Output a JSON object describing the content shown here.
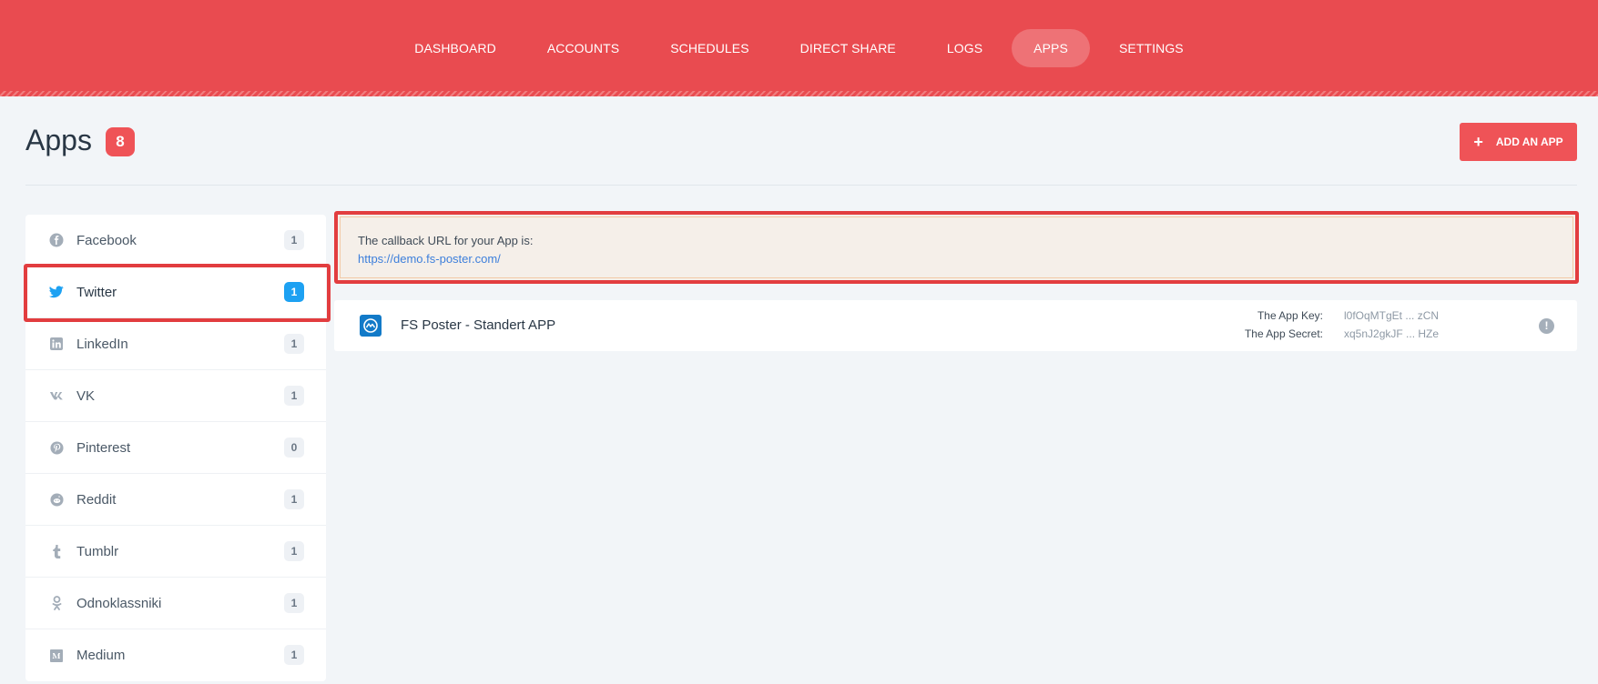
{
  "nav": {
    "items": [
      {
        "label": "DASHBOARD"
      },
      {
        "label": "ACCOUNTS"
      },
      {
        "label": "SCHEDULES"
      },
      {
        "label": "DIRECT SHARE"
      },
      {
        "label": "LOGS"
      },
      {
        "label": "APPS",
        "active": true
      },
      {
        "label": "SETTINGS"
      }
    ]
  },
  "header": {
    "title": "Apps",
    "count": "8",
    "add_button_label": "ADD AN APP",
    "add_button_icon": "+"
  },
  "sidebar": {
    "items": [
      {
        "label": "Facebook",
        "count": "1",
        "icon": "facebook-icon",
        "glyph": "f"
      },
      {
        "label": "Twitter",
        "count": "1",
        "icon": "twitter-icon",
        "glyph": "🐦",
        "active": true
      },
      {
        "label": "LinkedIn",
        "count": "1",
        "icon": "linkedin-icon",
        "glyph": "in"
      },
      {
        "label": "VK",
        "count": "1",
        "icon": "vk-icon",
        "glyph": "vk"
      },
      {
        "label": "Pinterest",
        "count": "0",
        "icon": "pinterest-icon",
        "glyph": "p"
      },
      {
        "label": "Reddit",
        "count": "1",
        "icon": "reddit-icon",
        "glyph": "●"
      },
      {
        "label": "Tumblr",
        "count": "1",
        "icon": "tumblr-icon",
        "glyph": "t"
      },
      {
        "label": "Odnoklassniki",
        "count": "1",
        "icon": "odnoklassniki-icon",
        "glyph": "ok"
      },
      {
        "label": "Medium",
        "count": "1",
        "icon": "medium-icon",
        "glyph": "M"
      }
    ]
  },
  "callback": {
    "text": "The callback URL for your App is:",
    "url": "https://demo.fs-poster.com/"
  },
  "app": {
    "name": "FS Poster - Standert APP",
    "key_label": "The App Key:",
    "key_value": "l0fOqMTgEt ... zCN",
    "secret_label": "The App Secret:",
    "secret_value": "xq5nJ2gkJF ... HZe",
    "info_glyph": "!"
  },
  "colors": {
    "brand": "#e94b50",
    "accent_twitter": "#1da1f2",
    "highlight": "#e23d3f"
  }
}
